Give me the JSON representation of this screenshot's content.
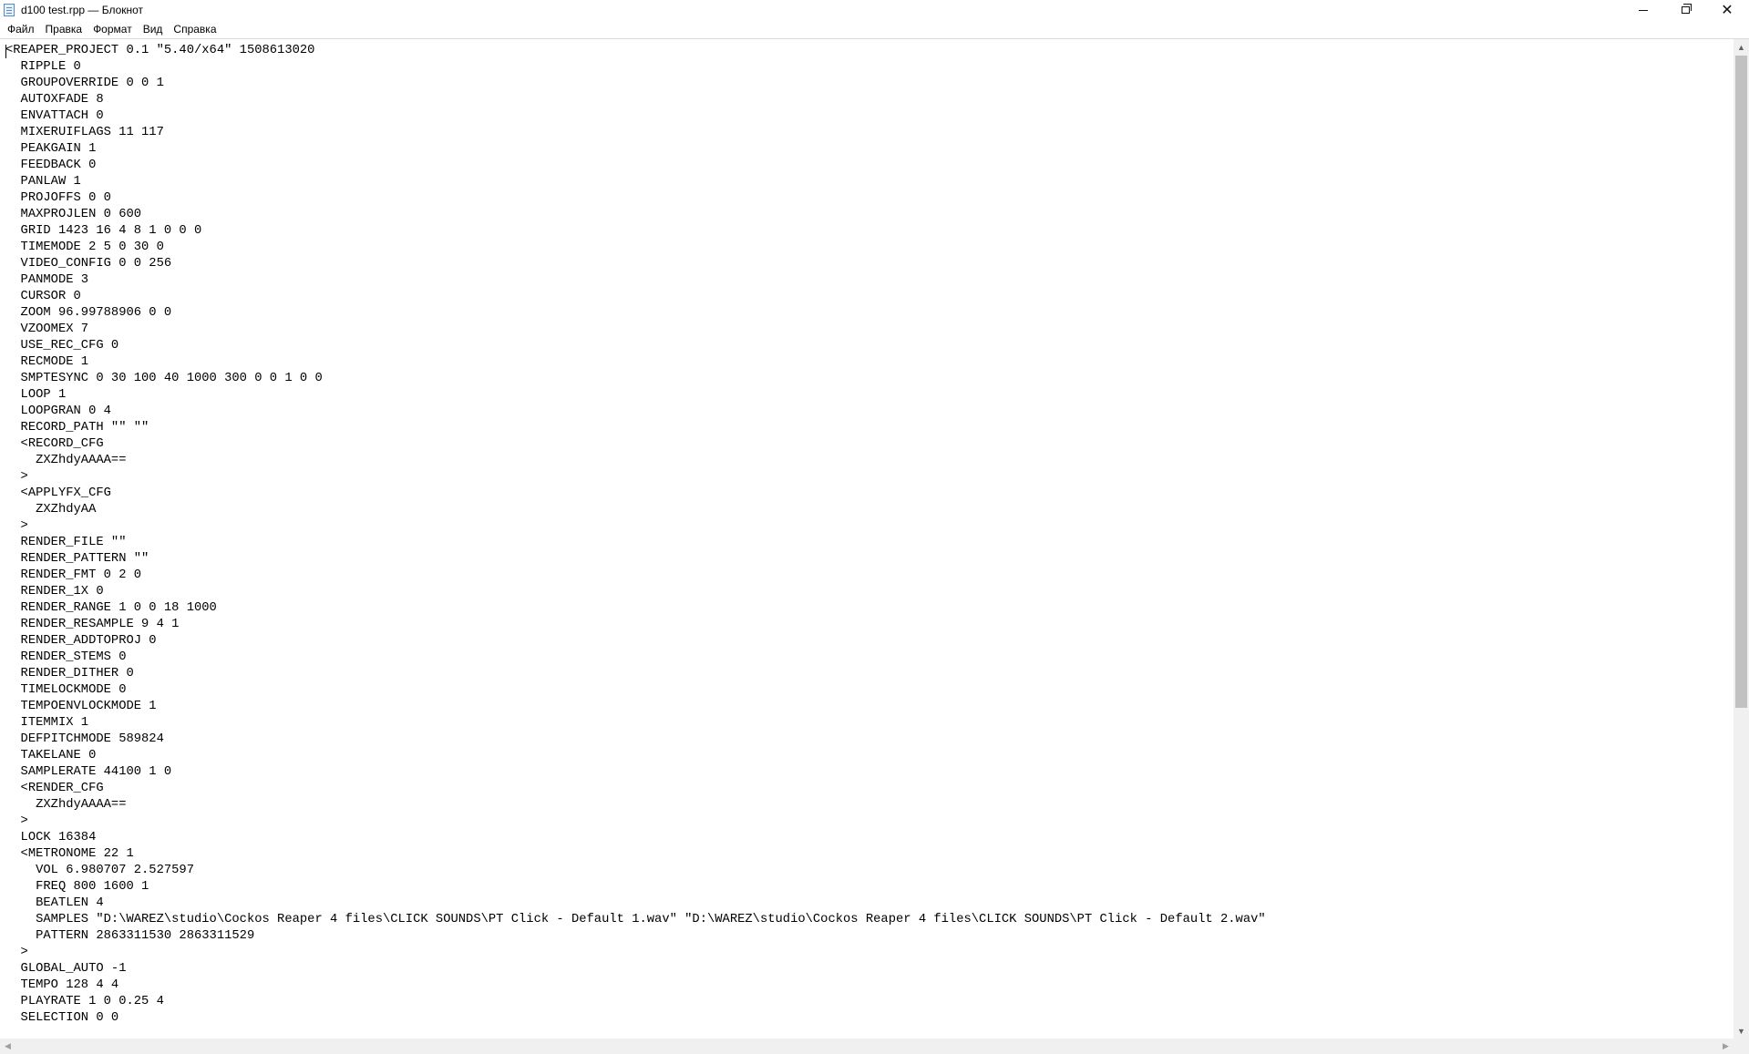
{
  "window": {
    "title": "d100 test.rpp — Блокнот",
    "icon": "notepad-icon",
    "controls": [
      "minimize-icon",
      "maximize-icon",
      "close-icon"
    ]
  },
  "menu": {
    "file": "Файл",
    "edit": "Правка",
    "format": "Формат",
    "view": "Вид",
    "help": "Справка"
  },
  "document": {
    "lines": [
      "<REAPER_PROJECT 0.1 \"5.40/x64\" 1508613020",
      "  RIPPLE 0",
      "  GROUPOVERRIDE 0 0 1",
      "  AUTOXFADE 8",
      "  ENVATTACH 0",
      "  MIXERUIFLAGS 11 117",
      "  PEAKGAIN 1",
      "  FEEDBACK 0",
      "  PANLAW 1",
      "  PROJOFFS 0 0",
      "  MAXPROJLEN 0 600",
      "  GRID 1423 16 4 8 1 0 0 0",
      "  TIMEMODE 2 5 0 30 0",
      "  VIDEO_CONFIG 0 0 256",
      "  PANMODE 3",
      "  CURSOR 0",
      "  ZOOM 96.99788906 0 0",
      "  VZOOMEX 7",
      "  USE_REC_CFG 0",
      "  RECMODE 1",
      "  SMPTESYNC 0 30 100 40 1000 300 0 0 1 0 0",
      "  LOOP 1",
      "  LOOPGRAN 0 4",
      "  RECORD_PATH \"\" \"\"",
      "  <RECORD_CFG",
      "    ZXZhdyAAAA==",
      "  >",
      "  <APPLYFX_CFG",
      "    ZXZhdyAA",
      "  >",
      "  RENDER_FILE \"\"",
      "  RENDER_PATTERN \"\"",
      "  RENDER_FMT 0 2 0",
      "  RENDER_1X 0",
      "  RENDER_RANGE 1 0 0 18 1000",
      "  RENDER_RESAMPLE 9 4 1",
      "  RENDER_ADDTOPROJ 0",
      "  RENDER_STEMS 0",
      "  RENDER_DITHER 0",
      "  TIMELOCKMODE 0",
      "  TEMPOENVLOCKMODE 1",
      "  ITEMMIX 1",
      "  DEFPITCHMODE 589824",
      "  TAKELANE 0",
      "  SAMPLERATE 44100 1 0",
      "  <RENDER_CFG",
      "    ZXZhdyAAAA==",
      "  >",
      "  LOCK 16384",
      "  <METRONOME 22 1",
      "    VOL 6.980707 2.527597",
      "    FREQ 800 1600 1",
      "    BEATLEN 4",
      "    SAMPLES \"D:\\WAREZ\\studio\\Cockos Reaper 4 files\\CLICK SOUNDS\\PT Click - Default 1.wav\" \"D:\\WAREZ\\studio\\Cockos Reaper 4 files\\CLICK SOUNDS\\PT Click - Default 2.wav\"",
      "    PATTERN 2863311530 2863311529",
      "  >",
      "  GLOBAL_AUTO -1",
      "  TEMPO 128 4 4",
      "  PLAYRATE 1 0 0.25 4",
      "  SELECTION 0 0"
    ]
  },
  "scrollbars": {
    "vertical": {
      "up_icon": "arrow-up-icon",
      "down_icon": "arrow-down-icon"
    },
    "horizontal": {
      "left_icon": "arrow-left-icon",
      "right_icon": "arrow-right-icon"
    }
  }
}
